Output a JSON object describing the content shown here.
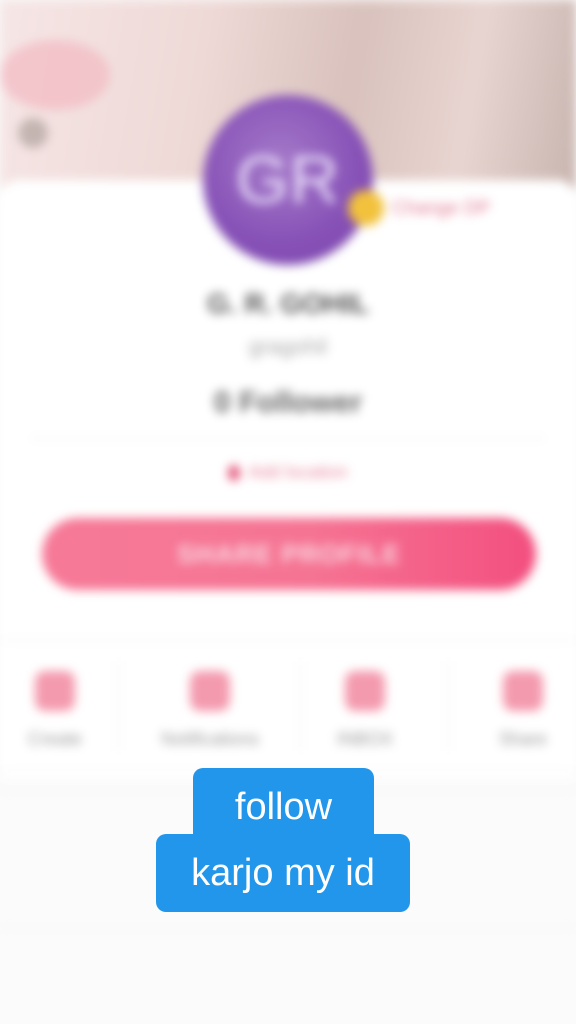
{
  "profile": {
    "initials": "GR",
    "badge_label": "Change DP",
    "name": "G. R. GOHIL",
    "handle": "gragohil",
    "followers": "0 Follower",
    "location": "Add location",
    "share_profile": "SHARE PROFILE"
  },
  "actions": [
    {
      "label": "Create",
      "icon": "camera-icon"
    },
    {
      "label": "Notifications",
      "icon": "bell-icon"
    },
    {
      "label": "INBOX",
      "icon": "chat-icon"
    },
    {
      "label": "Share",
      "icon": "share-icon"
    }
  ],
  "caption": {
    "line1": "follow",
    "line2": "karjo my id"
  },
  "colors": {
    "accent": "#f57393",
    "avatar": "#8650b6",
    "caption_bg": "#2196ea"
  }
}
